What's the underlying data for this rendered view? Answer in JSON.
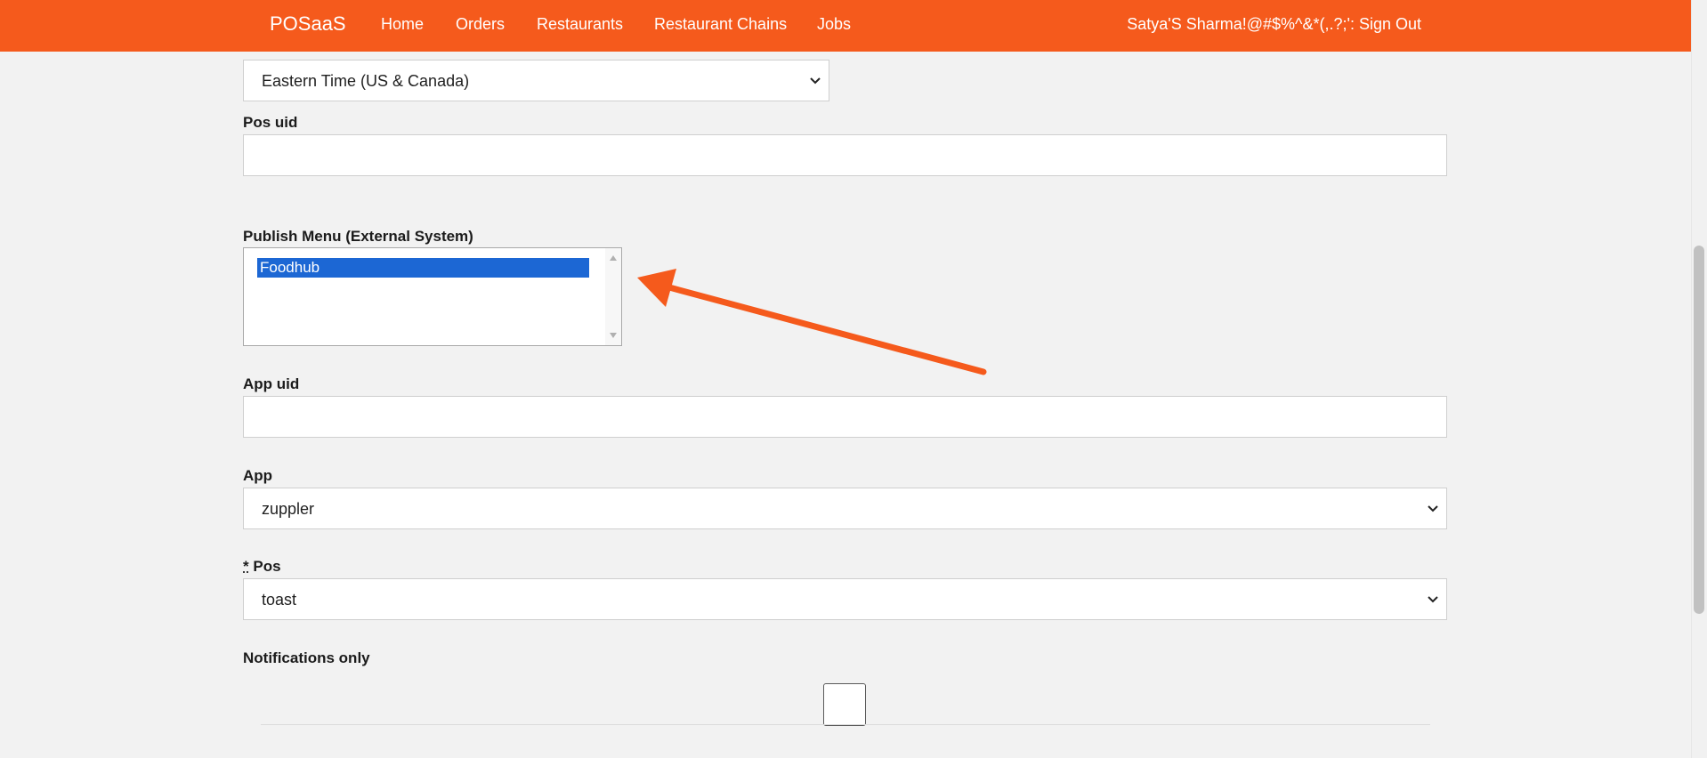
{
  "navbar": {
    "brand": "POSaaS",
    "links": [
      "Home",
      "Orders",
      "Restaurants",
      "Restaurant Chains",
      "Jobs"
    ],
    "user": "Satya'S Sharma!@#$%^&*(,.?;': Sign Out"
  },
  "form": {
    "timezone": {
      "value": "Eastern Time (US & Canada)"
    },
    "pos_uid": {
      "label": "Pos uid",
      "value": ""
    },
    "publish_menu": {
      "label": "Publish Menu (External System)",
      "options": [
        "Foodhub"
      ],
      "selected": "Foodhub"
    },
    "app_uid": {
      "label": "App uid",
      "value": ""
    },
    "app": {
      "label": "App",
      "value": "zuppler"
    },
    "pos": {
      "required_marker": "*",
      "label": "Pos",
      "value": "toast"
    },
    "notifications_only": {
      "label": "Notifications only",
      "checked": false
    }
  },
  "annotation": {
    "arrow_color": "#f55a1c",
    "icon": "arrow-annotation"
  },
  "colors": {
    "navbar": "#f55a1c",
    "background": "#f2f2f2",
    "selected_option": "#1c67d4"
  }
}
